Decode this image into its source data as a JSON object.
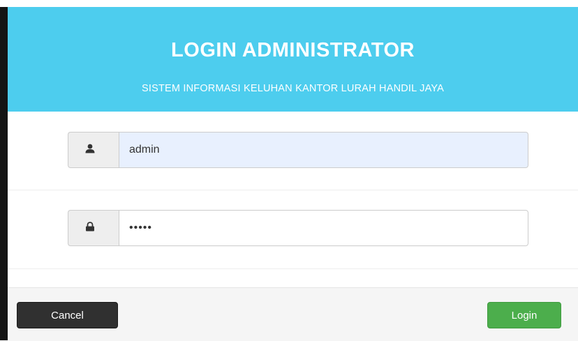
{
  "header": {
    "title": "LOGIN ADMINISTRATOR",
    "subtitle": "SISTEM INFORMASI KELUHAN KANTOR LURAH HANDIL JAYA"
  },
  "form": {
    "username": {
      "icon": "user-icon",
      "value": "admin"
    },
    "password": {
      "icon": "lock-icon",
      "value": "•••••"
    }
  },
  "footer": {
    "cancel_label": "Cancel",
    "login_label": "Login"
  },
  "colors": {
    "header_bg": "#4dcdee",
    "login_button": "#4cae4c",
    "cancel_button": "#303030",
    "autofill_bg": "#e8f0fe"
  }
}
